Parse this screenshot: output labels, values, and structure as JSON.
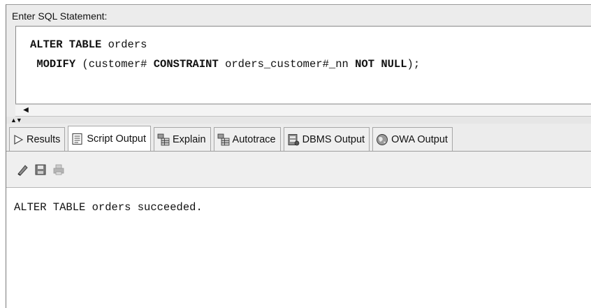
{
  "editor": {
    "label": "Enter SQL Statement:",
    "line1_kw": "ALTER TABLE",
    "line1_rest": " orders",
    "line2_kw1": "MODIFY",
    "line2_text1": " (customer# ",
    "line2_kw2": "CONSTRAINT",
    "line2_text2": " orders_customer#_nn ",
    "line2_kw3": "NOT NULL",
    "line2_text3": ");"
  },
  "tabs": [
    {
      "label": "Results",
      "icon": "play-arrow-icon"
    },
    {
      "label": "Script Output",
      "icon": "document-icon",
      "active": true
    },
    {
      "label": "Explain",
      "icon": "table-tree-icon"
    },
    {
      "label": "Autotrace",
      "icon": "table-tree-icon"
    },
    {
      "label": "DBMS Output",
      "icon": "dbms-icon"
    },
    {
      "label": "OWA Output",
      "icon": "globe-icon"
    }
  ],
  "toolbar": {
    "icons": [
      "eraser-icon",
      "save-icon",
      "print-icon"
    ]
  },
  "output": {
    "text": "ALTER TABLE orders succeeded."
  },
  "colors": {
    "panel_bg": "#ececec",
    "editor_bg": "#ffffff",
    "tab_border": "#a7a7a7"
  }
}
